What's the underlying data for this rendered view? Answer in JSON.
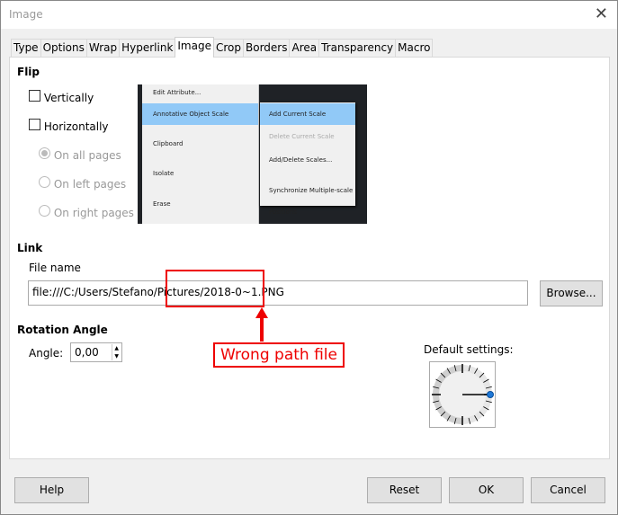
{
  "window": {
    "title": "Image",
    "close": "✕"
  },
  "tabs": [
    "Type",
    "Options",
    "Wrap",
    "Hyperlink",
    "Image",
    "Crop",
    "Borders",
    "Area",
    "Transparency",
    "Macro"
  ],
  "active_tab": "Image",
  "flip": {
    "heading": "Flip",
    "vertically": "Vertically",
    "horizontally": "Horizontally",
    "all_pages": "On all pages",
    "left_pages": "On left pages",
    "right_pages": "On right pages"
  },
  "preview_menu": {
    "items": [
      "Edit Attribute...",
      "Annotative Object Scale",
      "Clipboard",
      "Isolate",
      "Erase"
    ],
    "submenu": [
      "Add Current Scale",
      "Delete Current Scale",
      "Add/Delete Scales...",
      "Synchronize Multiple-scale Positions"
    ]
  },
  "link": {
    "heading": "Link",
    "file_label": "File name",
    "file_value": "file:///C:/Users/Stefano/Pictures/2018-0~1.PNG",
    "browse": "Browse..."
  },
  "rotation": {
    "heading": "Rotation Angle",
    "angle_label": "Angle:",
    "angle_value": "0,00",
    "default_settings": "Default settings:"
  },
  "annotation": {
    "text": "Wrong path file",
    "color": "#e00000"
  },
  "buttons": {
    "help": "Help",
    "reset": "Reset",
    "ok": "OK",
    "cancel": "Cancel"
  }
}
